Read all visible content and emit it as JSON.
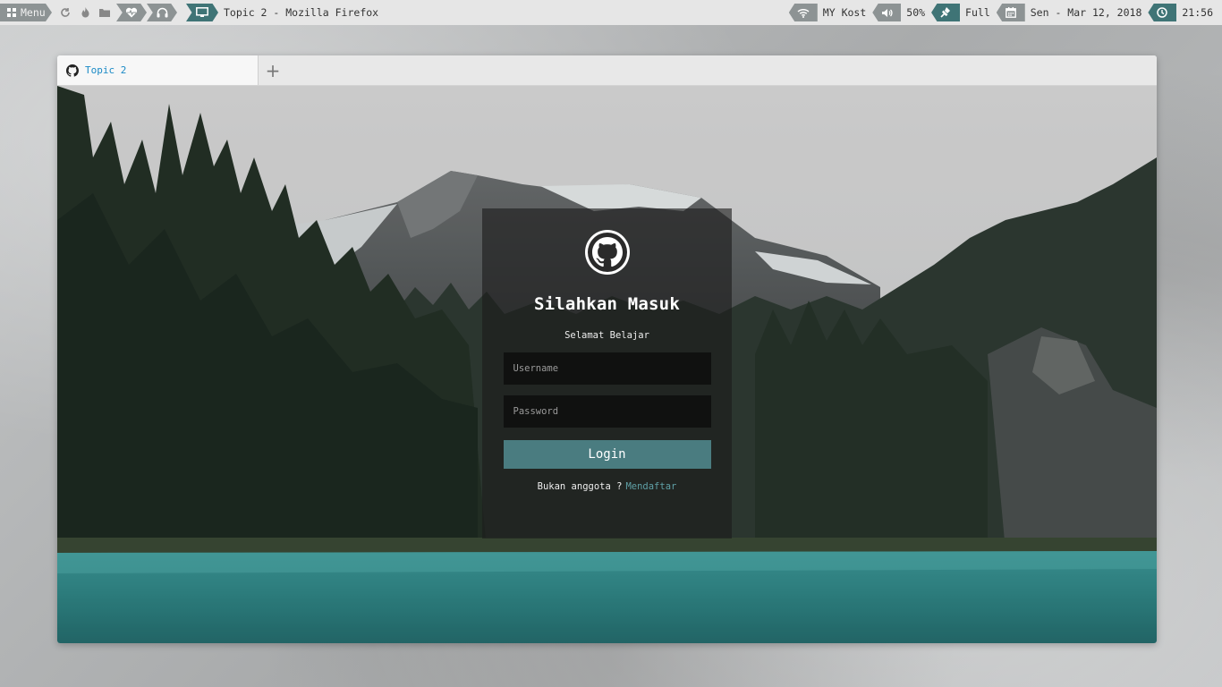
{
  "panel": {
    "menu_label": "Menu",
    "window_title": "Topic 2 - Mozilla Firefox",
    "wifi_label": "MY Kost",
    "volume_label": "50%",
    "battery_label": "Full",
    "date_label": "Sen - Mar 12, 2018",
    "clock_label": "21:56",
    "icons": [
      "grid-icon",
      "refresh-icon",
      "flame-icon",
      "folder-icon",
      "heartbeat-icon",
      "headphones-icon",
      "monitor-icon",
      "wifi-icon",
      "speaker-icon",
      "plug-icon",
      "calendar-icon",
      "clock-icon"
    ],
    "accent": "#3f7476",
    "segment_color": "#8d9394"
  },
  "browser": {
    "tab_title": "Topic 2",
    "new_tab_symbol": "+"
  },
  "login": {
    "title": "Silahkan Masuk",
    "subtitle": "Selamat Belajar",
    "username_placeholder": "Username",
    "password_placeholder": "Password",
    "button_label": "Login",
    "signup_prompt": "Bukan anggota ?",
    "signup_link": "Mendaftar",
    "button_color": "#4a7c80",
    "link_color": "#5fa0a6"
  }
}
